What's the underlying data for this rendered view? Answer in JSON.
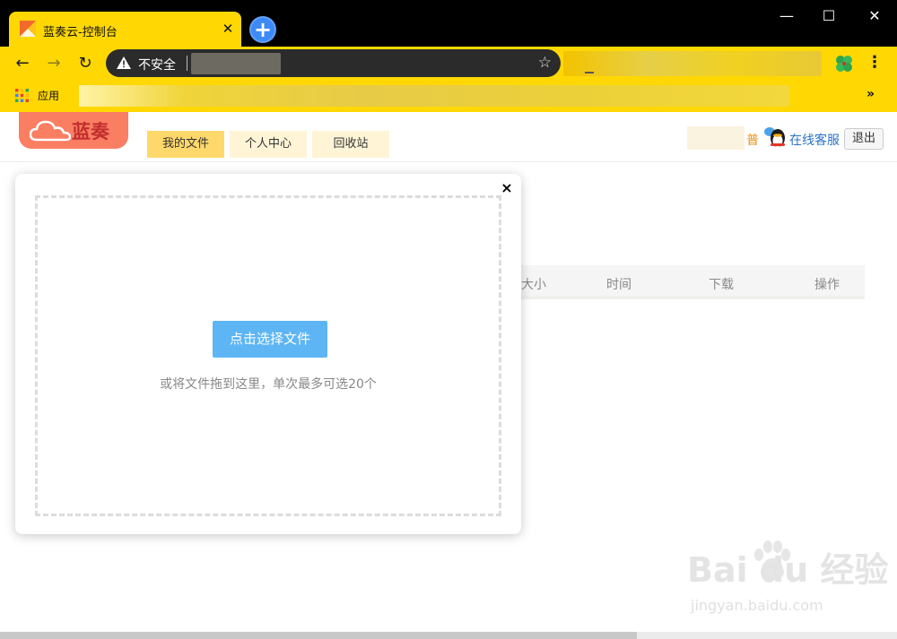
{
  "browser": {
    "tab_title": "蓝奏云-控制台",
    "new_tab_label": "+",
    "security_label": "不安全",
    "bookmarks_apps_label": "应用",
    "bookmarks_more": "»",
    "window_controls": {
      "minimize": "—",
      "maximize": "☐",
      "close": "✕"
    }
  },
  "site": {
    "logo_text": "蓝奏",
    "nav_tabs": [
      {
        "label": "我的文件",
        "active": true
      },
      {
        "label": "个人中心",
        "active": false
      },
      {
        "label": "回收站",
        "active": false
      }
    ],
    "user_level": "普",
    "support_link": "在线客服",
    "logout_label": "退出"
  },
  "file_table": {
    "columns": [
      "大小",
      "时间",
      "下载",
      "操作"
    ]
  },
  "upload_modal": {
    "close_label": "×",
    "select_button": "点击选择文件",
    "drop_hint": "或将文件拖到这里，单次最多可选20个"
  },
  "watermark": {
    "main": "Bai  du 经验",
    "sub": "jingyan.baidu.com"
  },
  "colors": {
    "browser_theme": "#ffd803",
    "select_button": "#5db5f3",
    "logo_bg": "#fa7e62",
    "active_tab": "#ffd86b"
  }
}
